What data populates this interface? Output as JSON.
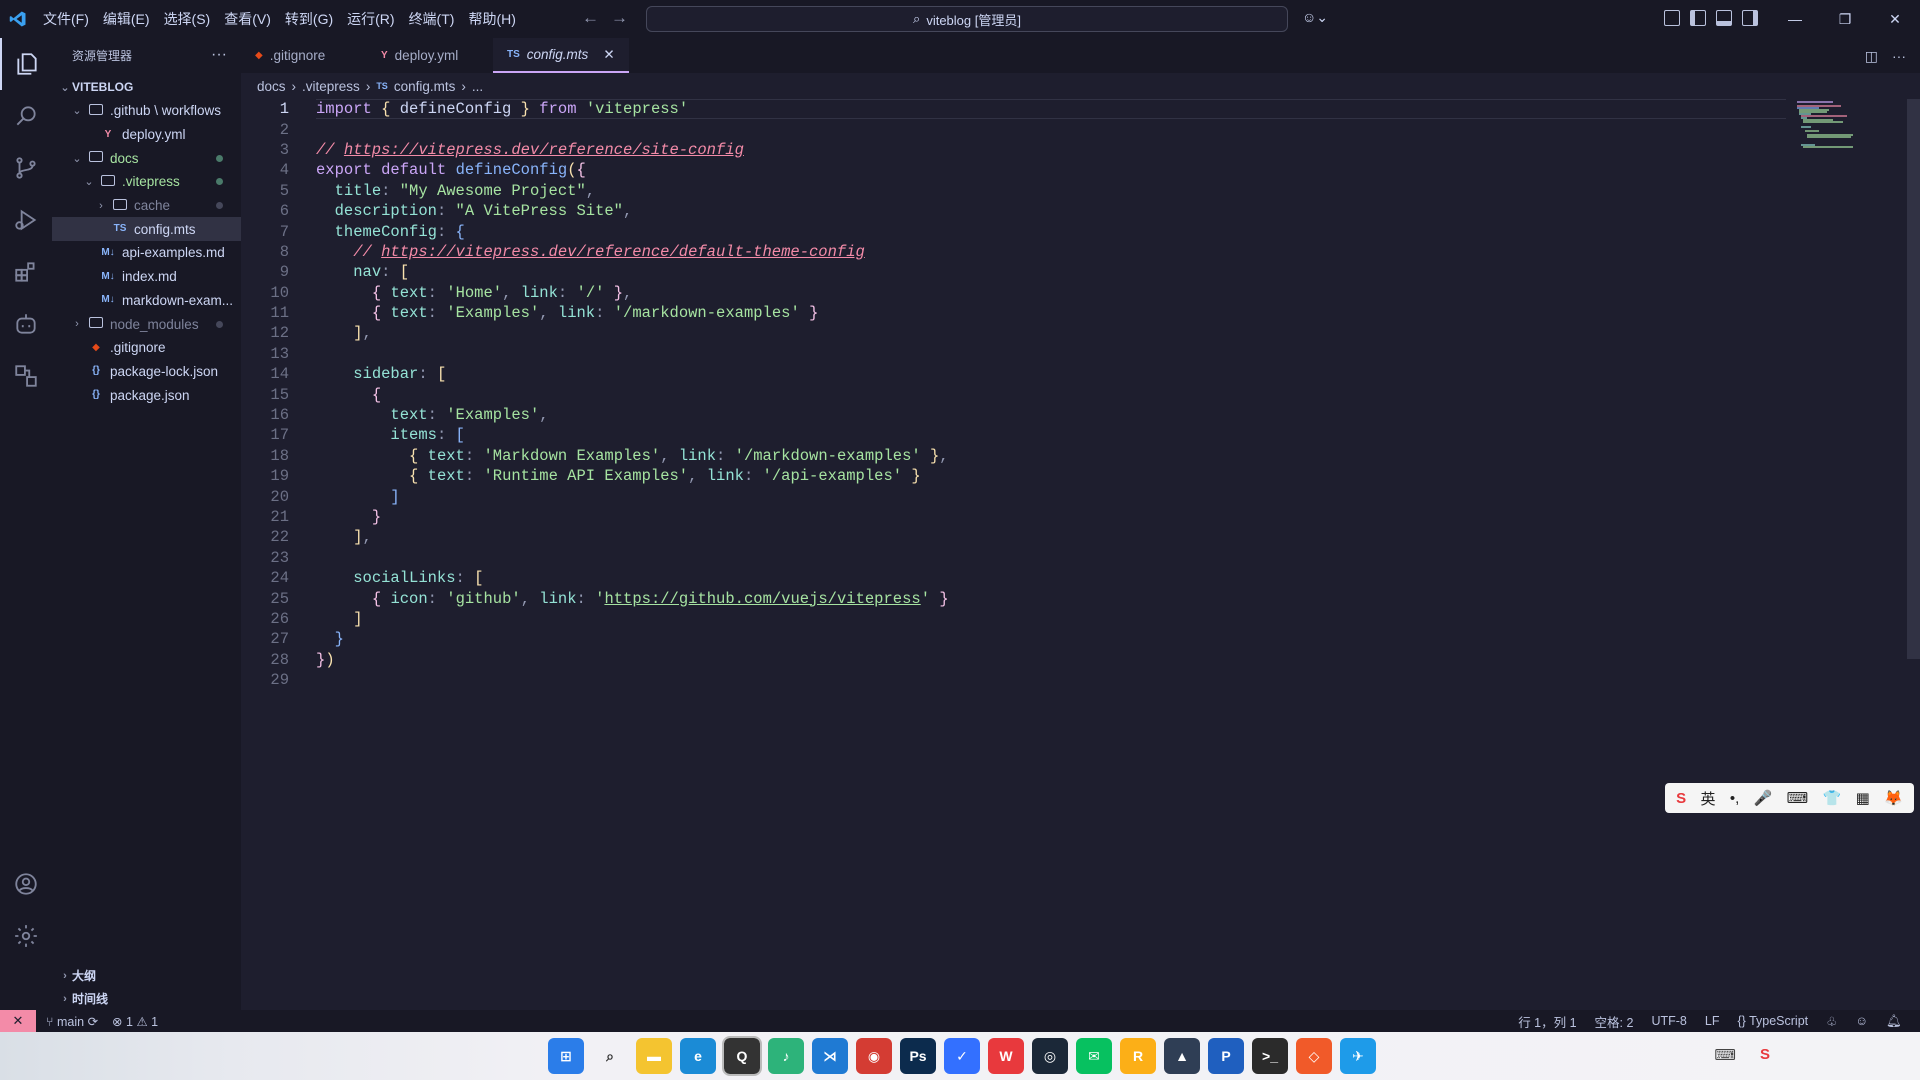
{
  "titlebar": {
    "menu": [
      "文件(F)",
      "编辑(E)",
      "选择(S)",
      "查看(V)",
      "转到(G)",
      "运行(R)",
      "终端(T)",
      "帮助(H)"
    ],
    "search": "viteblog [管理员]"
  },
  "sidebar": {
    "header": "资源管理器",
    "root": "VITEBLOG",
    "items": [
      {
        "label": ".github \\ workflows",
        "indent": 1,
        "kind": "folder",
        "open": true
      },
      {
        "label": "deploy.yml",
        "indent": 2,
        "kind": "yml"
      },
      {
        "label": "docs",
        "indent": 1,
        "kind": "folder",
        "open": true,
        "dot": "green"
      },
      {
        "label": ".vitepress",
        "indent": 2,
        "kind": "folder",
        "open": true,
        "dot": "green"
      },
      {
        "label": "cache",
        "indent": 3,
        "kind": "folder",
        "open": false,
        "dot": "grey"
      },
      {
        "label": "config.mts",
        "indent": 3,
        "kind": "ts",
        "selected": true
      },
      {
        "label": "api-examples.md",
        "indent": 2,
        "kind": "md"
      },
      {
        "label": "index.md",
        "indent": 2,
        "kind": "md"
      },
      {
        "label": "markdown-exam...",
        "indent": 2,
        "kind": "md"
      },
      {
        "label": "node_modules",
        "indent": 1,
        "kind": "folder",
        "open": false,
        "dot": "grey"
      },
      {
        "label": ".gitignore",
        "indent": 1,
        "kind": "git"
      },
      {
        "label": "package-lock.json",
        "indent": 1,
        "kind": "json"
      },
      {
        "label": "package.json",
        "indent": 1,
        "kind": "json"
      }
    ],
    "outline": "大纲",
    "timeline": "时间线"
  },
  "tabs": [
    {
      "label": ".gitignore",
      "icon": "◆",
      "color": "#e64a19"
    },
    {
      "label": "deploy.yml",
      "icon": "Y",
      "color": "#f38ba8"
    },
    {
      "label": "config.mts",
      "icon": "TS",
      "color": "#89b4fa",
      "active": true
    }
  ],
  "breadcrumb": [
    "docs",
    ".vitepress",
    "config.mts",
    "..."
  ],
  "statusbar": {
    "branch": "main",
    "errors": "1",
    "warnings": "1",
    "position": "行 1，列 1",
    "spaces": "空格: 2",
    "encoding": "UTF-8",
    "eol": "LF",
    "language": "TypeScript"
  },
  "ime": [
    "S",
    "英",
    "•,",
    "🎤",
    "⌨",
    "👕",
    "▦",
    "🦊"
  ],
  "code": [
    [
      [
        "kw",
        "import"
      ],
      [
        "txt",
        " "
      ],
      [
        "br1",
        "{"
      ],
      [
        "txt",
        " defineConfig "
      ],
      [
        "br1",
        "}"
      ],
      [
        "txt",
        " "
      ],
      [
        "kw",
        "from"
      ],
      [
        "txt",
        " "
      ],
      [
        "str",
        "'vitepress'"
      ]
    ],
    [],
    [
      [
        "cmt",
        "// "
      ],
      [
        "cmt link",
        "https://vitepress.dev/reference/site-config"
      ]
    ],
    [
      [
        "kw",
        "export"
      ],
      [
        "txt",
        " "
      ],
      [
        "kw",
        "default"
      ],
      [
        "txt",
        " "
      ],
      [
        "fn",
        "defineConfig"
      ],
      [
        "br1",
        "("
      ],
      [
        "br2",
        "{"
      ]
    ],
    [
      [
        "txt",
        "  "
      ],
      [
        "prop",
        "title"
      ],
      [
        "pun",
        ": "
      ],
      [
        "str",
        "\"My Awesome Project\""
      ],
      [
        "pun",
        ","
      ]
    ],
    [
      [
        "txt",
        "  "
      ],
      [
        "prop",
        "description"
      ],
      [
        "pun",
        ": "
      ],
      [
        "str",
        "\"A VitePress Site\""
      ],
      [
        "pun",
        ","
      ]
    ],
    [
      [
        "txt",
        "  "
      ],
      [
        "prop",
        "themeConfig"
      ],
      [
        "pun",
        ": "
      ],
      [
        "br3",
        "{"
      ]
    ],
    [
      [
        "txt",
        "    "
      ],
      [
        "cmt",
        "// "
      ],
      [
        "cmt link",
        "https://vitepress.dev/reference/default-theme-config"
      ]
    ],
    [
      [
        "txt",
        "    "
      ],
      [
        "prop",
        "nav"
      ],
      [
        "pun",
        ": "
      ],
      [
        "br1",
        "["
      ]
    ],
    [
      [
        "txt",
        "      "
      ],
      [
        "br2",
        "{"
      ],
      [
        "txt",
        " "
      ],
      [
        "prop",
        "text"
      ],
      [
        "pun",
        ": "
      ],
      [
        "str",
        "'Home'"
      ],
      [
        "pun",
        ", "
      ],
      [
        "prop",
        "link"
      ],
      [
        "pun",
        ": "
      ],
      [
        "str",
        "'/'"
      ],
      [
        "txt",
        " "
      ],
      [
        "br2",
        "}"
      ],
      [
        "pun",
        ","
      ]
    ],
    [
      [
        "txt",
        "      "
      ],
      [
        "br2",
        "{"
      ],
      [
        "txt",
        " "
      ],
      [
        "prop",
        "text"
      ],
      [
        "pun",
        ": "
      ],
      [
        "str",
        "'Examples'"
      ],
      [
        "pun",
        ", "
      ],
      [
        "prop",
        "link"
      ],
      [
        "pun",
        ": "
      ],
      [
        "str",
        "'/markdown-examples'"
      ],
      [
        "txt",
        " "
      ],
      [
        "br2",
        "}"
      ]
    ],
    [
      [
        "txt",
        "    "
      ],
      [
        "br1",
        "]"
      ],
      [
        "pun",
        ","
      ]
    ],
    [],
    [
      [
        "txt",
        "    "
      ],
      [
        "prop",
        "sidebar"
      ],
      [
        "pun",
        ": "
      ],
      [
        "br1",
        "["
      ]
    ],
    [
      [
        "txt",
        "      "
      ],
      [
        "br2",
        "{"
      ]
    ],
    [
      [
        "txt",
        "        "
      ],
      [
        "prop",
        "text"
      ],
      [
        "pun",
        ": "
      ],
      [
        "str",
        "'Examples'"
      ],
      [
        "pun",
        ","
      ]
    ],
    [
      [
        "txt",
        "        "
      ],
      [
        "prop",
        "items"
      ],
      [
        "pun",
        ": "
      ],
      [
        "br3",
        "["
      ]
    ],
    [
      [
        "txt",
        "          "
      ],
      [
        "br1",
        "{"
      ],
      [
        "txt",
        " "
      ],
      [
        "prop",
        "text"
      ],
      [
        "pun",
        ": "
      ],
      [
        "str",
        "'Markdown Examples'"
      ],
      [
        "pun",
        ", "
      ],
      [
        "prop",
        "link"
      ],
      [
        "pun",
        ": "
      ],
      [
        "str",
        "'/markdown-examples'"
      ],
      [
        "txt",
        " "
      ],
      [
        "br1",
        "}"
      ],
      [
        "pun",
        ","
      ]
    ],
    [
      [
        "txt",
        "          "
      ],
      [
        "br1",
        "{"
      ],
      [
        "txt",
        " "
      ],
      [
        "prop",
        "text"
      ],
      [
        "pun",
        ": "
      ],
      [
        "str",
        "'Runtime API Examples'"
      ],
      [
        "pun",
        ", "
      ],
      [
        "prop",
        "link"
      ],
      [
        "pun",
        ": "
      ],
      [
        "str",
        "'/api-examples'"
      ],
      [
        "txt",
        " "
      ],
      [
        "br1",
        "}"
      ]
    ],
    [
      [
        "txt",
        "        "
      ],
      [
        "br3",
        "]"
      ]
    ],
    [
      [
        "txt",
        "      "
      ],
      [
        "br2",
        "}"
      ]
    ],
    [
      [
        "txt",
        "    "
      ],
      [
        "br1",
        "]"
      ],
      [
        "pun",
        ","
      ]
    ],
    [],
    [
      [
        "txt",
        "    "
      ],
      [
        "prop",
        "socialLinks"
      ],
      [
        "pun",
        ": "
      ],
      [
        "br1",
        "["
      ]
    ],
    [
      [
        "txt",
        "      "
      ],
      [
        "br2",
        "{"
      ],
      [
        "txt",
        " "
      ],
      [
        "prop",
        "icon"
      ],
      [
        "pun",
        ": "
      ],
      [
        "str",
        "'github'"
      ],
      [
        "pun",
        ", "
      ],
      [
        "prop",
        "link"
      ],
      [
        "pun",
        ": "
      ],
      [
        "str",
        "'"
      ],
      [
        "str link",
        "https://github.com/vuejs/vitepress"
      ],
      [
        "str",
        "'"
      ],
      [
        "txt",
        " "
      ],
      [
        "br2",
        "}"
      ]
    ],
    [
      [
        "txt",
        "    "
      ],
      [
        "br1",
        "]"
      ]
    ],
    [
      [
        "txt",
        "  "
      ],
      [
        "br3",
        "}"
      ]
    ],
    [
      [
        "br2",
        "}"
      ],
      [
        "br1",
        ")"
      ]
    ],
    []
  ],
  "taskbar": [
    {
      "name": "windows-start-icon",
      "glyph": "⊞",
      "bg": "#2b7de9"
    },
    {
      "name": "search-icon",
      "glyph": "⌕",
      "bg": "transparent",
      "color": "#333"
    },
    {
      "name": "file-explorer-icon",
      "glyph": "▬",
      "bg": "#f4c430"
    },
    {
      "name": "edge-icon",
      "glyph": "e",
      "bg": "#1b8bd6"
    },
    {
      "name": "qq-icon",
      "glyph": "Q",
      "bg": "#333"
    },
    {
      "name": "music-icon",
      "glyph": "♪",
      "bg": "#2db37a"
    },
    {
      "name": "vscode-icon",
      "glyph": "⋊",
      "bg": "#1f7ad3"
    },
    {
      "name": "netease-music-icon",
      "glyph": "◉",
      "bg": "#d43c33"
    },
    {
      "name": "photoshop-icon",
      "glyph": "Ps",
      "bg": "#0c2b4d"
    },
    {
      "name": "feishu-icon",
      "glyph": "✓",
      "bg": "#3370ff"
    },
    {
      "name": "wps-icon",
      "glyph": "W",
      "bg": "#e8393d"
    },
    {
      "name": "steam-icon",
      "glyph": "◎",
      "bg": "#1b2838"
    },
    {
      "name": "wechat-icon",
      "glyph": "✉",
      "bg": "#07c160"
    },
    {
      "name": "rockstar-icon",
      "glyph": "R",
      "bg": "#fcaf17"
    },
    {
      "name": "cat-app-icon",
      "glyph": "▲",
      "bg": "#2f3e55"
    },
    {
      "name": "p-app-icon",
      "glyph": "P",
      "bg": "#1f5fbf"
    },
    {
      "name": "terminal-icon",
      "glyph": ">_",
      "bg": "#2b2b2b"
    },
    {
      "name": "git-app-icon",
      "glyph": "◇",
      "bg": "#f15a29"
    },
    {
      "name": "send-app-icon",
      "glyph": "✈",
      "bg": "#1e9be9"
    }
  ]
}
